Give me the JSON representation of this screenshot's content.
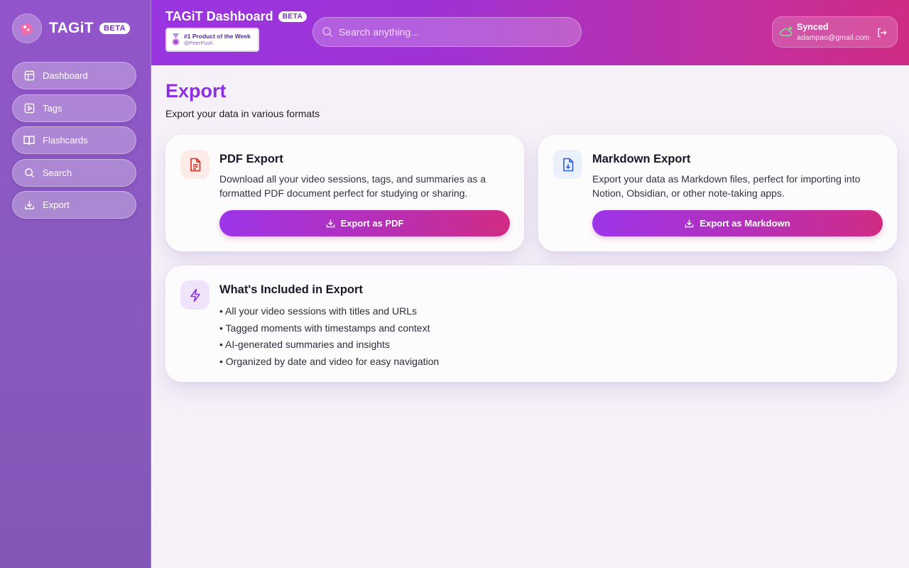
{
  "sidebar": {
    "brand": "TAGiT",
    "badge": "BETA",
    "items": [
      {
        "label": "Dashboard",
        "icon": "layout-icon"
      },
      {
        "label": "Tags",
        "icon": "play-square-icon"
      },
      {
        "label": "Flashcards",
        "icon": "book-open-icon"
      },
      {
        "label": "Search",
        "icon": "search-icon"
      },
      {
        "label": "Export",
        "icon": "download-icon"
      }
    ]
  },
  "header": {
    "title": "TAGiT Dashboard",
    "badge": "BETA",
    "award": {
      "line1": "#1 Product of the Week",
      "line2": "@PeerPush"
    },
    "search_placeholder": "Search anything...",
    "user": {
      "status": "Synced",
      "email": "adampao@gmail.com"
    }
  },
  "main": {
    "title": "Export",
    "subtitle": "Export your data in various formats",
    "pdf": {
      "title": "PDF Export",
      "desc": "Download all your video sessions, tags, and summaries as a formatted PDF document perfect for studying or sharing.",
      "button": "Export as PDF"
    },
    "markdown": {
      "title": "Markdown Export",
      "desc": "Export your data as Markdown files, perfect for importing into Notion, Obsidian, or other note-taking apps.",
      "button": "Export as Markdown"
    },
    "included": {
      "title": "What's Included in Export",
      "items": [
        "All your video sessions with titles and URLs",
        "Tagged moments with timestamps and context",
        "AI-generated summaries and insights",
        "Organized by date and video for easy navigation"
      ]
    }
  },
  "colors": {
    "accent": "#8e2fe0",
    "gradient_start": "#9d35e8",
    "gradient_end": "#d12b83",
    "sidebar": "#8a5bc0"
  }
}
